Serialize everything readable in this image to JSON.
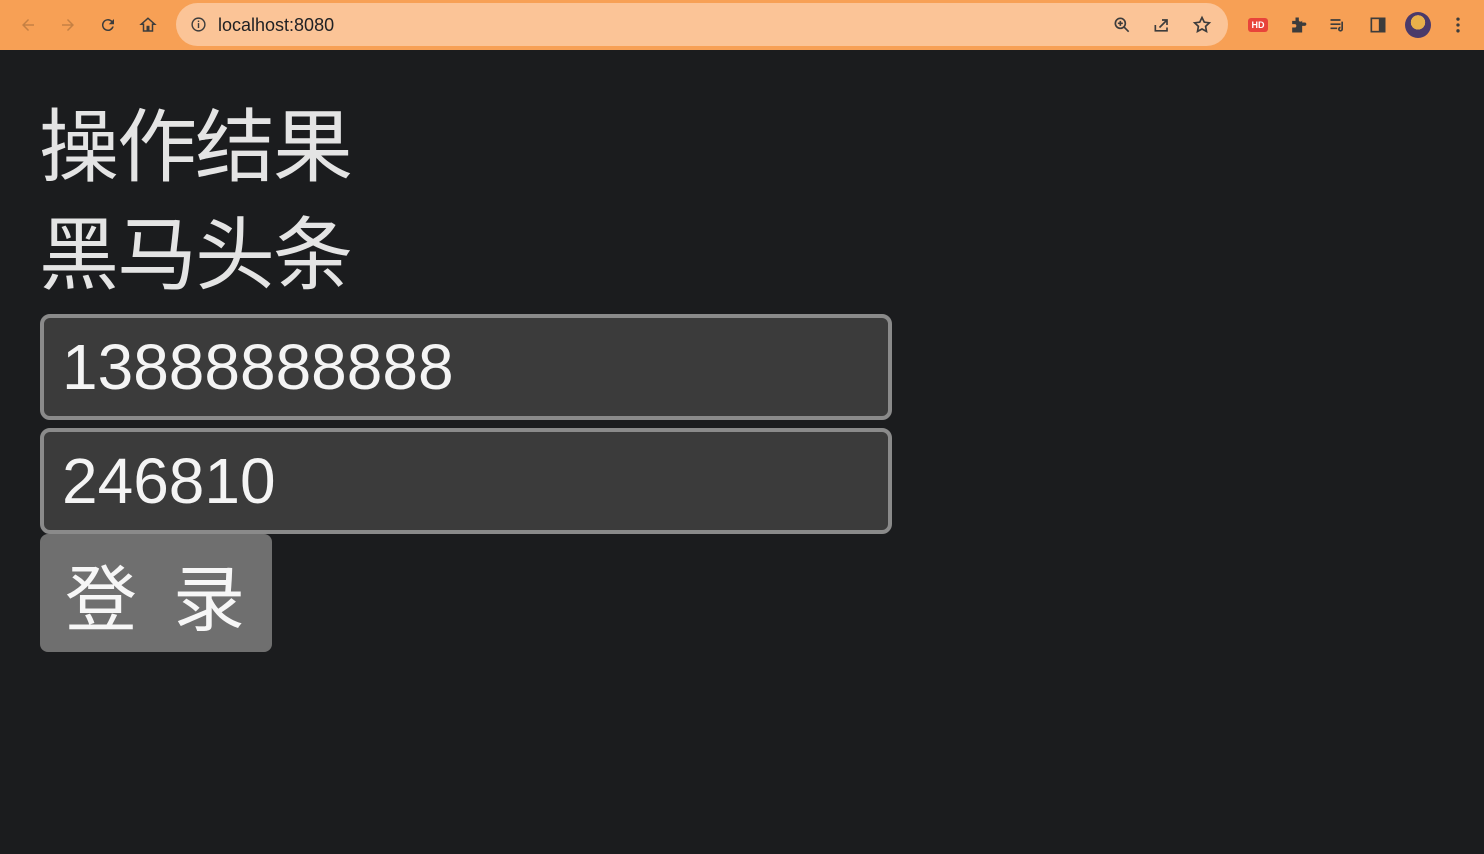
{
  "browser": {
    "url": "localhost:8080",
    "accent_color": "#f7a055",
    "omnibox_color": "#fbc497",
    "extension_badge": "HD",
    "icons": [
      "back-icon",
      "forward-icon",
      "reload-icon",
      "home-icon",
      "info-icon",
      "zoom-icon",
      "share-icon",
      "star-icon",
      "extensions-icon",
      "reading-list-icon",
      "side-panel-icon",
      "avatar",
      "menu-icon"
    ]
  },
  "page": {
    "title": "操作结果",
    "subtitle": "黑马头条",
    "form": {
      "phone_value": "13888888888",
      "code_value": "246810",
      "login_label": "登 录"
    },
    "background_color": "#1b1c1e"
  }
}
